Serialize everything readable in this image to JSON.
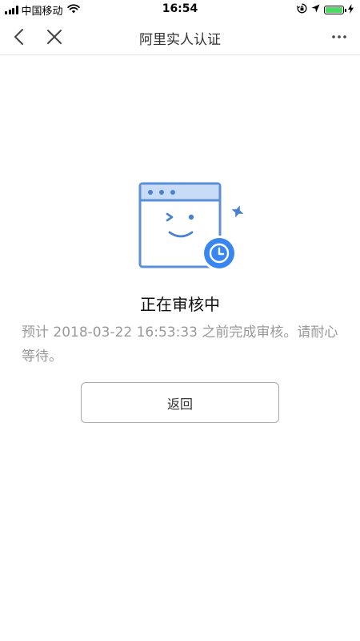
{
  "status_bar": {
    "carrier": "中国移动",
    "time": "16:54",
    "battery_level": 1.0,
    "icons": [
      "signal-icon",
      "wifi-icon",
      "rotation-lock-icon",
      "location-icon",
      "battery-icon",
      "charging-icon"
    ]
  },
  "nav": {
    "title": "阿里实人认证",
    "icons": [
      "back-icon",
      "close-icon",
      "more-icon"
    ]
  },
  "content": {
    "illustration_icons": [
      "browser-face-icon",
      "clock-icon",
      "sparkle-icon"
    ],
    "status_title": "正在审核中",
    "status_desc": "预计 2018-03-22 16:53:33 之前完成审核。请耐心等待。",
    "return_label": "返回"
  },
  "colors": {
    "accent": "#3a86f0",
    "illustration_line": "#5b8fd6",
    "illustration_fill": "#c9dcf7",
    "text_primary": "#111111",
    "text_secondary": "#999999",
    "battery": "#4cd964"
  }
}
